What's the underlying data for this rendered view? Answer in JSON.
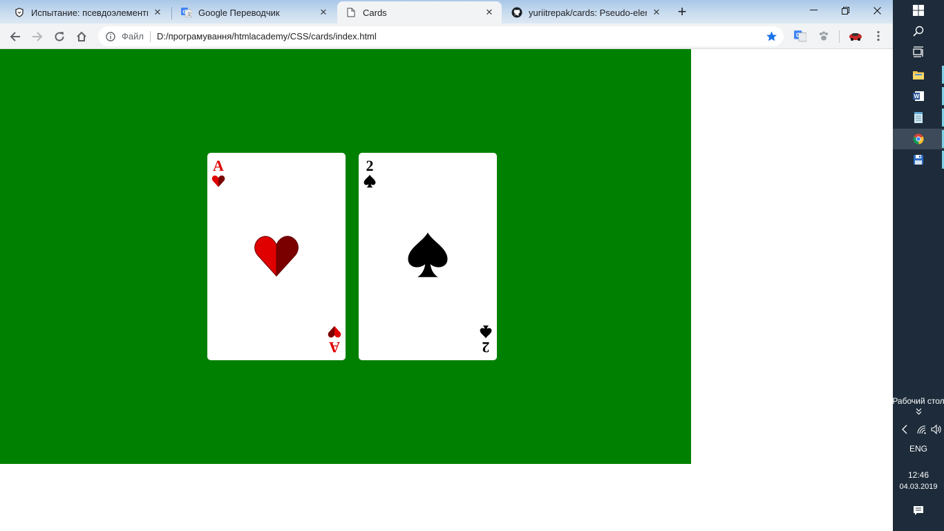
{
  "tabs": [
    {
      "title": "Испытание: псевдоэлементы — ",
      "icon": "shield-icon"
    },
    {
      "title": "Google Переводчик",
      "icon": "google-translate-icon"
    },
    {
      "title": "Cards",
      "icon": "document-icon",
      "active": true
    },
    {
      "title": "yuriitrepak/cards: Pseudo-elemen",
      "icon": "github-icon"
    }
  ],
  "address_bar": {
    "scheme_label": "Файл",
    "url": "D:/програмування/htmlacademy/CSS/cards/index.html"
  },
  "page": {
    "background_color": "#008000",
    "cards": [
      {
        "rank": "A",
        "suit": "hearts",
        "color": "#e00000"
      },
      {
        "rank": "2",
        "suit": "spades",
        "color": "#000000"
      }
    ]
  },
  "taskbar": {
    "desktop_label": "Рабочий стол",
    "language": "ENG",
    "time": "12:46",
    "date": "04.03.2019"
  }
}
